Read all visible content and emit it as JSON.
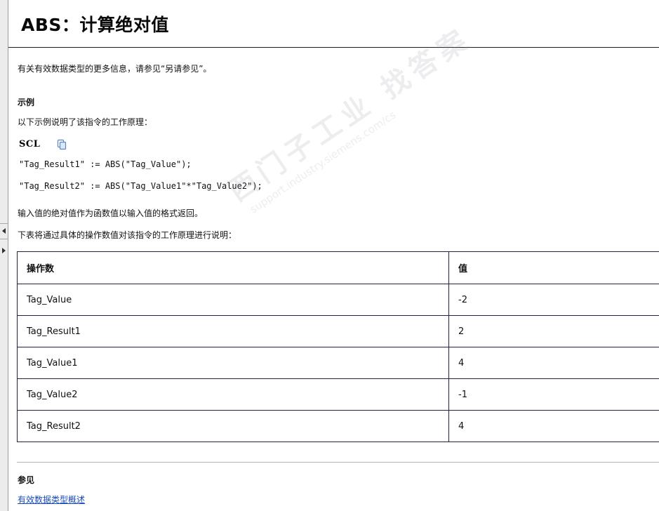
{
  "page": {
    "title": "ABS：计算绝对值",
    "intro": "有关有效数据类型的更多信息，请参见“另请参见”。",
    "example_heading": "示例",
    "example_intro": "以下示例说明了该指令的工作原理：",
    "result_note": "输入值的绝对值作为函数值以输入值的格式返回。",
    "table_intro": "下表将通过具体的操作数值对该指令的工作原理进行说明："
  },
  "code": {
    "language": "SCL",
    "copy_icon": "copy-icon",
    "lines": [
      "\"Tag_Result1\" := ABS(\"Tag_Value\");",
      "\"Tag_Result2\" := ABS(\"Tag_Value1\"*\"Tag_Value2\");"
    ]
  },
  "table": {
    "headers": [
      "操作数",
      "值"
    ],
    "rows": [
      [
        "Tag_Value",
        "-2"
      ],
      [
        "Tag_Result1",
        "2"
      ],
      [
        "Tag_Value1",
        "4"
      ],
      [
        "Tag_Value2",
        "-1"
      ],
      [
        "Tag_Result2",
        "4"
      ]
    ]
  },
  "see_also": {
    "heading": "参见",
    "link": "有效数据类型概述"
  },
  "watermark": {
    "chinese": "西门子工业 找答案",
    "url": "support.industry.siemens.com/cs"
  },
  "colors": {
    "link": "#1a4bb8",
    "table_border": "#1f2340"
  }
}
